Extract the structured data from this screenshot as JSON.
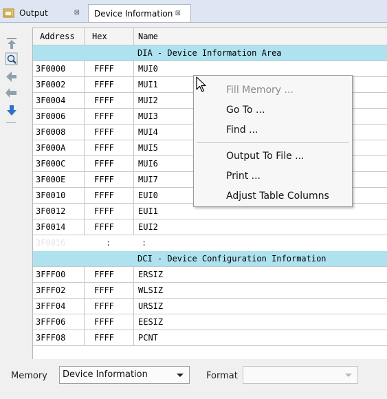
{
  "tabs": [
    {
      "label": "Output",
      "close": "⊠"
    },
    {
      "label": "Device Information",
      "close": "⊠"
    }
  ],
  "table": {
    "columns": [
      "Address",
      "Hex",
      "Name"
    ],
    "section1_title": "DIA - Device Information Area",
    "section1_rows": [
      {
        "address": "3F0000",
        "hex": "FFFF",
        "name": "MUI0"
      },
      {
        "address": "3F0002",
        "hex": "FFFF",
        "name": "MUI1"
      },
      {
        "address": "3F0004",
        "hex": "FFFF",
        "name": "MUI2"
      },
      {
        "address": "3F0006",
        "hex": "FFFF",
        "name": "MUI3"
      },
      {
        "address": "3F0008",
        "hex": "FFFF",
        "name": "MUI4"
      },
      {
        "address": "3F000A",
        "hex": "FFFF",
        "name": "MUI5"
      },
      {
        "address": "3F000C",
        "hex": "FFFF",
        "name": "MUI6"
      },
      {
        "address": "3F000E",
        "hex": "FFFF",
        "name": "MUI7"
      },
      {
        "address": "3F0010",
        "hex": "FFFF",
        "name": "EUI0"
      },
      {
        "address": "3F0012",
        "hex": "FFFF",
        "name": "EUI1"
      },
      {
        "address": "3F0014",
        "hex": "FFFF",
        "name": "EUI2"
      }
    ],
    "gap_row": {
      "address": "3F0016",
      "hex": ":",
      "name": ":"
    },
    "section2_title": "DCI - Device Configuration Information",
    "section2_rows": [
      {
        "address": "3FFF00",
        "hex": "FFFF",
        "name": "ERSIZ"
      },
      {
        "address": "3FFF02",
        "hex": "FFFF",
        "name": "WLSIZ"
      },
      {
        "address": "3FFF04",
        "hex": "FFFF",
        "name": "URSIZ"
      },
      {
        "address": "3FFF06",
        "hex": "FFFF",
        "name": "EESIZ"
      },
      {
        "address": "3FFF08",
        "hex": "FFFF",
        "name": "PCNT"
      }
    ]
  },
  "context_menu": {
    "items": [
      "Fill Memory ...",
      "Go To ...",
      "Find ...",
      "Output To File ...",
      "Print ...",
      "Adjust Table Columns"
    ],
    "disabled_item": "Fill Memory ..."
  },
  "bottom": {
    "memory_label": "Memory",
    "memory_value": "Device Information",
    "format_label": "Format",
    "format_value": ""
  },
  "toolbar_icons": [
    "page-up-icon",
    "search-icon",
    "prev-icon",
    "back-icon",
    "arrow-down-icon"
  ],
  "colors": {
    "section_bg": "#aee2ef",
    "tabbar_bg": "#dde6f2",
    "toolbar_arrow": "#8fa1ad",
    "toolbar_blue": "#2f71c7"
  }
}
